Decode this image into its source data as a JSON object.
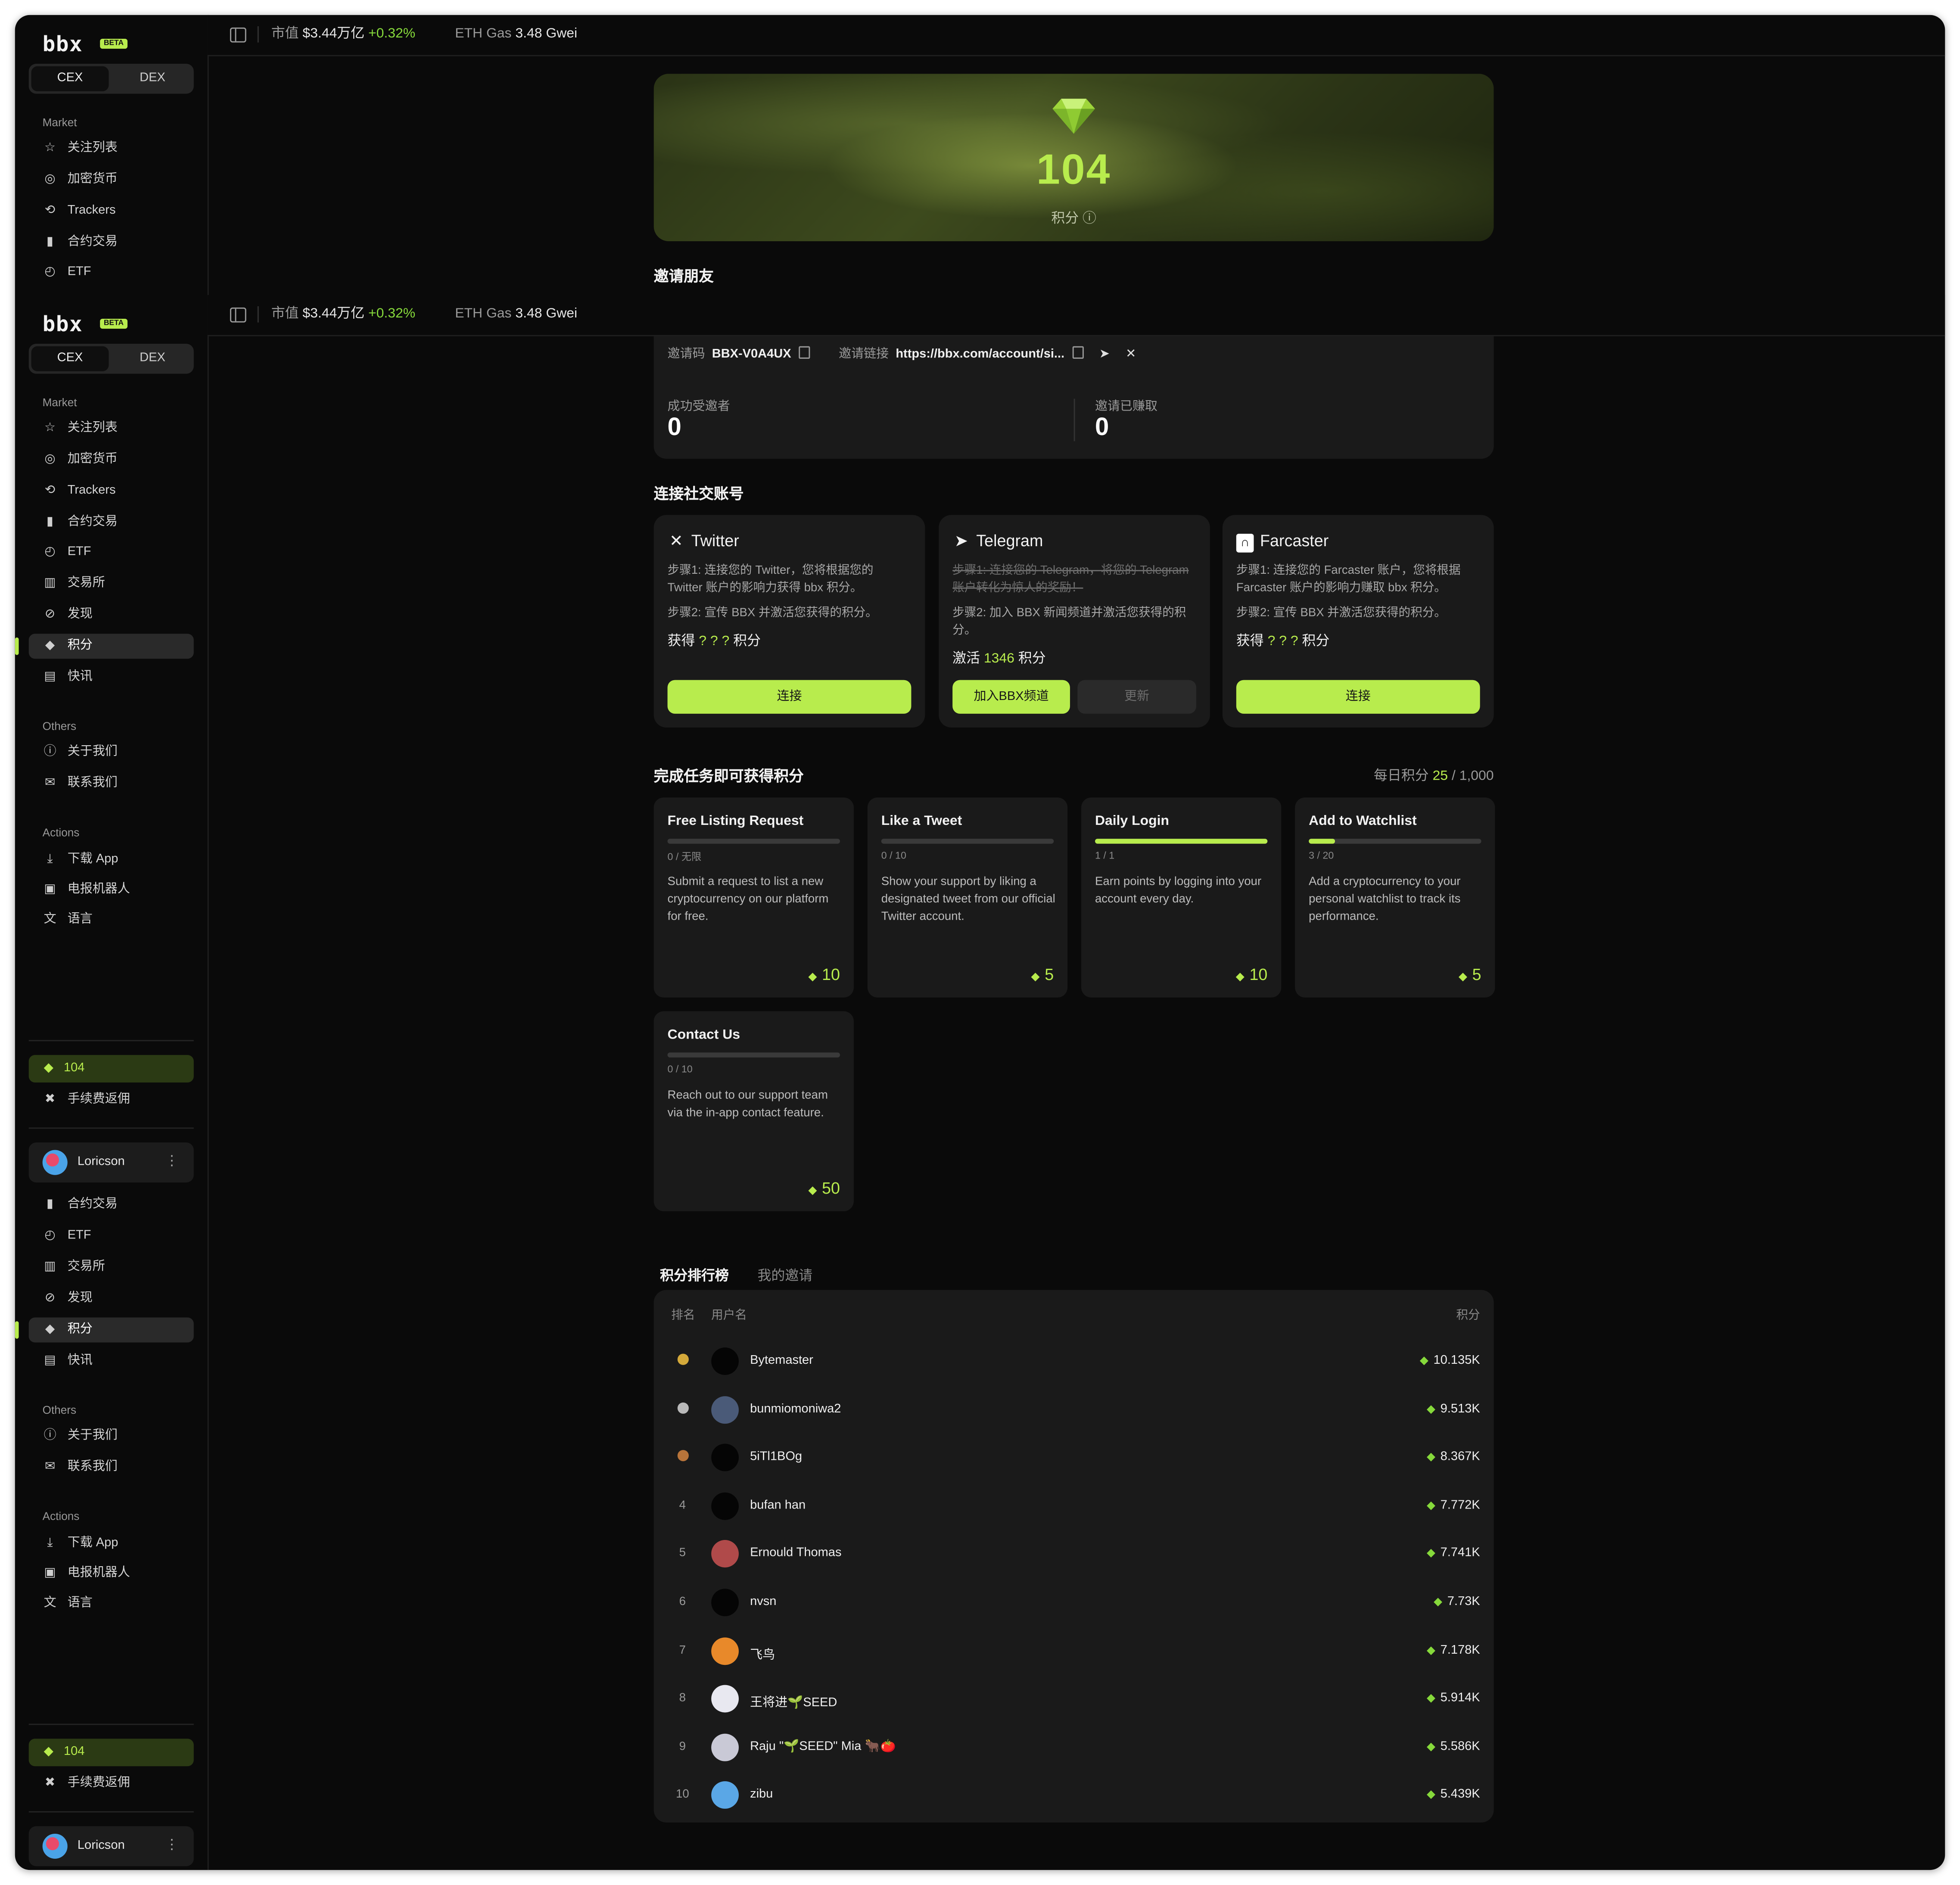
{
  "brand": {
    "logo": "bbx",
    "badge": "BETA"
  },
  "mode_toggle": {
    "cex": "CEX",
    "dex": "DEX"
  },
  "topbar": {
    "mcap_label": "市值",
    "mcap_value": "$3.44万亿",
    "mcap_change": "+0.32%",
    "gas_label": "ETH Gas",
    "gas_value": "3.48 Gwei"
  },
  "sidebar": {
    "market_label": "Market",
    "market_items": [
      {
        "label": "关注列表",
        "icon": "star-icon"
      },
      {
        "label": "加密货币",
        "icon": "coin-icon"
      },
      {
        "label": "Trackers",
        "icon": "tracker-icon"
      },
      {
        "label": "合约交易",
        "icon": "bar-chart-icon"
      },
      {
        "label": "ETF",
        "icon": "trend-icon"
      },
      {
        "label": "交易所",
        "icon": "exchange-icon"
      },
      {
        "label": "发现",
        "icon": "compass-icon"
      },
      {
        "label": "积分",
        "icon": "gem-icon",
        "active": true
      },
      {
        "label": "快讯",
        "icon": "news-icon"
      }
    ],
    "others_label": "Others",
    "others_items": [
      {
        "label": "关于我们",
        "icon": "info-icon"
      },
      {
        "label": "联系我们",
        "icon": "mail-icon"
      }
    ],
    "actions_label": "Actions",
    "actions_items": [
      {
        "label": "下载 App",
        "icon": "download-icon"
      },
      {
        "label": "电报机器人",
        "icon": "bot-icon"
      },
      {
        "label": "语言",
        "icon": "language-icon"
      }
    ],
    "points": "104",
    "rebate": "手续费返佣",
    "user": "Loricson"
  },
  "hero": {
    "points": "104",
    "label": "积分"
  },
  "invite": {
    "title": "邀请朋友",
    "code_label": "邀请码",
    "code": "BBX-V0A4UX",
    "link_label": "邀请链接",
    "link": "https://bbx.com/account/si...",
    "invitees_label": "成功受邀者",
    "invitees": "0",
    "earned_label": "邀请已赚取",
    "earned": "0"
  },
  "social": {
    "title": "连接社交账号",
    "twitter": {
      "name": "Twitter",
      "step1": "步骤1: 连接您的 Twitter，您将根据您的 Twitter 账户的影响力获得 bbx 积分。",
      "step2": "步骤2: 宣传 BBX 并激活您获得的积分。",
      "earn_prefix": "获得",
      "earn_value": "? ? ?",
      "earn_suffix": "积分",
      "button": "连接"
    },
    "telegram": {
      "name": "Telegram",
      "step1": "步骤1: 连接您的 Telegram，将您的 Telegram 账户转化为惊人的奖励！",
      "step2": "步骤2: 加入 BBX 新闻频道并激活您获得的积分。",
      "earn_prefix": "激活",
      "earn_value": "1346",
      "earn_suffix": "积分",
      "button": "加入BBX频道",
      "button2": "更新"
    },
    "farcaster": {
      "name": "Farcaster",
      "step1": "步骤1: 连接您的 Farcaster 账户，您将根据 Farcaster 账户的影响力赚取 bbx 积分。",
      "step2": "步骤2: 宣传 BBX 并激活您获得的积分。",
      "earn_prefix": "获得",
      "earn_value": "? ? ?",
      "earn_suffix": "积分",
      "button": "连接"
    }
  },
  "tasks": {
    "title": "完成任务即可获得积分",
    "daily_label": "每日积分",
    "daily_current": "25",
    "daily_total": "/ 1,000",
    "items": [
      {
        "title": "Free Listing Request",
        "progress": "0 / 无限",
        "ratio": 0,
        "desc": "Submit a request to list a new cryptocurrency on our platform for free.",
        "reward": "10"
      },
      {
        "title": "Like a Tweet",
        "progress": "0 / 10",
        "ratio": 0,
        "desc": "Show your support by liking a designated tweet from our official Twitter account.",
        "reward": "5"
      },
      {
        "title": "Daily Login",
        "progress": "1 / 1",
        "ratio": 1,
        "desc": "Earn points by logging into your account every day.",
        "reward": "10"
      },
      {
        "title": "Add to Watchlist",
        "progress": "3 / 20",
        "ratio": 0.15,
        "desc": "Add a cryptocurrency to your personal watchlist to track its performance.",
        "reward": "5"
      },
      {
        "title": "Contact Us",
        "progress": "0 / 10",
        "ratio": 0,
        "desc": "Reach out to our support team via the in-app contact feature.",
        "reward": "50"
      }
    ]
  },
  "leaderboard": {
    "tab_active": "积分排行榜",
    "tab_other": "我的邀请",
    "col_rank": "排名",
    "col_user": "用户名",
    "col_points": "积分",
    "rows": [
      {
        "rank": "",
        "medal": "#d4a93a",
        "user": "Bytemaster",
        "points": "10.135K",
        "avatar": "#050505"
      },
      {
        "rank": "",
        "medal": "#b9b9b9",
        "user": "bunmiomoniwa2",
        "points": "9.513K",
        "avatar": "#4a5a78"
      },
      {
        "rank": "",
        "medal": "#b8743a",
        "user": "5iTl1BOg",
        "points": "8.367K",
        "avatar": "#050505"
      },
      {
        "rank": "4",
        "user": "bufan han",
        "points": "7.772K",
        "avatar": "#050505"
      },
      {
        "rank": "5",
        "user": "Ernould Thomas",
        "points": "7.741K",
        "avatar": "#b04a4a"
      },
      {
        "rank": "6",
        "user": "nvsn",
        "points": "7.73K",
        "avatar": "#050505"
      },
      {
        "rank": "7",
        "user": "飞鸟",
        "points": "7.178K",
        "avatar": "#e8892a"
      },
      {
        "rank": "8",
        "user": "王将进🌱SEED",
        "points": "5.914K",
        "avatar": "#e8e8f0"
      },
      {
        "rank": "9",
        "user": "Raju \"🌱SEED\" Mia 🐂🍅",
        "points": "5.586K",
        "avatar": "#c9c9d6"
      },
      {
        "rank": "10",
        "user": "zibu",
        "points": "5.439K",
        "avatar": "#5aa7e6"
      }
    ]
  },
  "colors": {
    "accent": "#b8ec4d",
    "positive": "#86d93b",
    "card": "#1a1a1a",
    "bg": "#0a0a0a"
  }
}
